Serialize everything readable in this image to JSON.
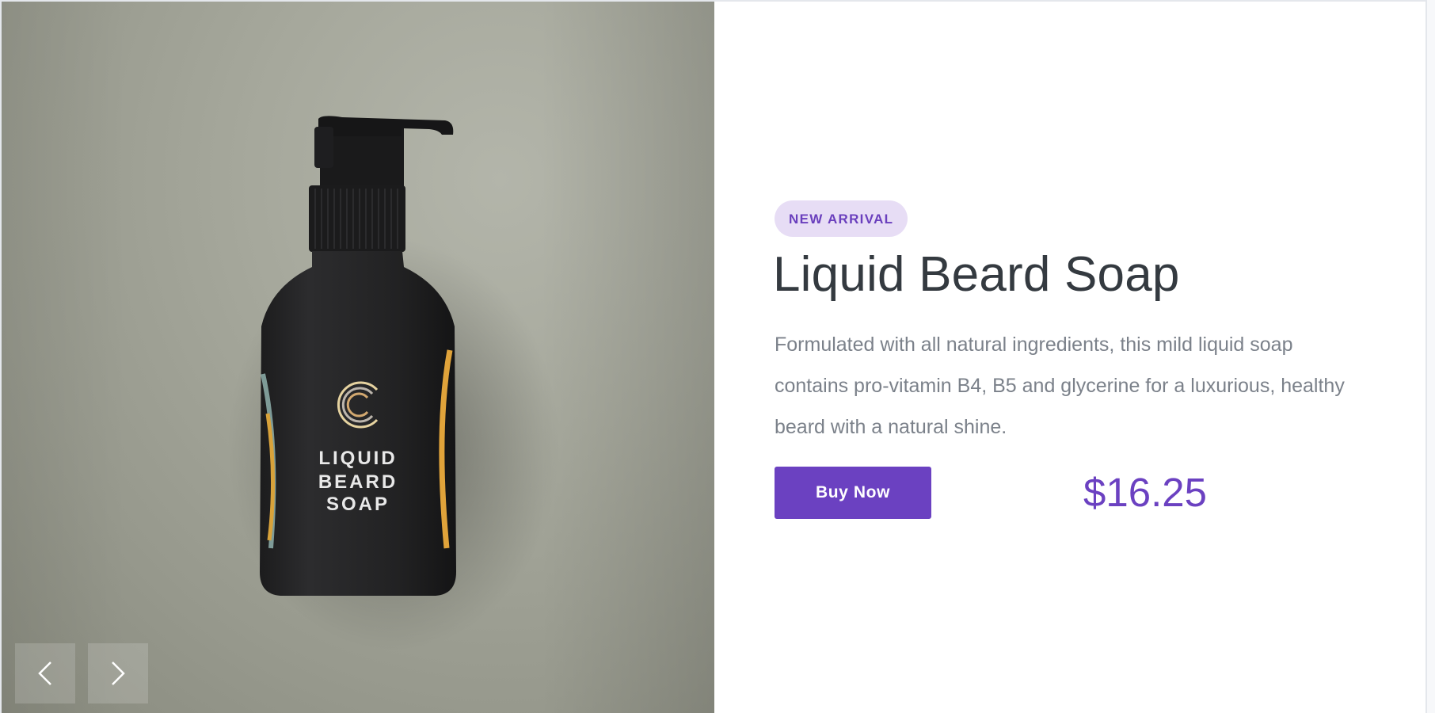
{
  "product": {
    "badge": "NEW ARRIVAL",
    "title": "Liquid Beard Soap",
    "description": "Formulated with all natural ingredients, this mild liquid soap contains pro-vitamin B4, B5 and glycerine for a luxurious, healthy beard with a natural shine.",
    "buy_label": "Buy Now",
    "price": "$16.25",
    "bottle_label_lines": [
      "LIQUID",
      "BEARD",
      "SOAP"
    ]
  },
  "gallery": {
    "prev_icon": "chevron-left-icon",
    "next_icon": "chevron-right-icon"
  },
  "colors": {
    "accent": "#6b41c1",
    "badge_bg": "#e7ddf5",
    "title": "#343a40",
    "body_text": "#7b818a",
    "image_bg": "#a6a89c"
  }
}
